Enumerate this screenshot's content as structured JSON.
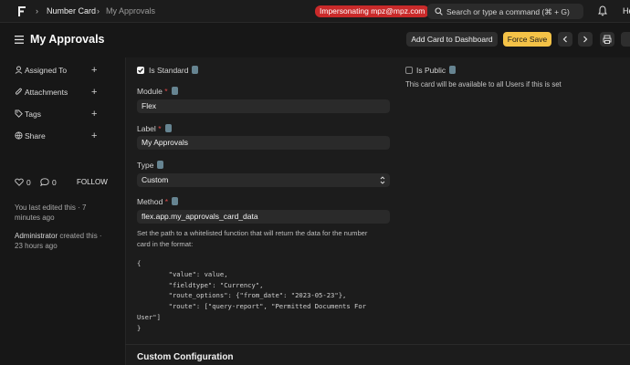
{
  "navbar": {
    "breadcrumbs": [
      "Number Card",
      "My Approvals"
    ],
    "impersonating": "Impersonating mpz@mpz.com",
    "search_placeholder": "Search or type a command (⌘ + G)",
    "user_initials_cut": "He"
  },
  "page": {
    "title": "My Approvals",
    "add_to_dashboard_label": "Add Card to Dashboard",
    "force_save_label": "Force Save"
  },
  "sidebar": {
    "items": [
      {
        "label": "Assigned To",
        "icon": "user-icon"
      },
      {
        "label": "Attachments",
        "icon": "paperclip-icon"
      },
      {
        "label": "Tags",
        "icon": "tag-icon"
      },
      {
        "label": "Share",
        "icon": "share-icon"
      }
    ],
    "likes": "0",
    "comments": "0",
    "follow_label": "FOLLOW",
    "edited_text": "You last edited this · 7 minutes ago",
    "created_by": "Administrator",
    "created_text": " created this · 23 hours ago"
  },
  "form": {
    "is_standard_label": "Is Standard",
    "is_standard_checked": true,
    "is_public_label": "Is Public",
    "is_public_checked": false,
    "is_public_desc": "This card will be available to all Users if this is set",
    "module_label": "Module",
    "module_value": "Flex",
    "label_label": "Label",
    "label_value": "My Approvals",
    "type_label": "Type",
    "type_value": "Custom",
    "method_label": "Method",
    "method_value": "flex.app.my_approvals_card_data",
    "method_desc_line1": "Set the path to a whitelisted function that will return the data for the number",
    "method_desc_line2": "card in the format:",
    "code_block": "{\n        \"value\": value,\n        \"fieldtype\": \"Currency\",\n        \"route_options\": {\"from_date\": \"2023-05-23\"},\n        \"route\": [\"query-report\", \"Permitted Documents For\nUser\"]\n}",
    "custom_config_title": "Custom Configuration"
  },
  "colors": {
    "background": "#171717",
    "panel": "#1c1c1c",
    "badge_red": "#c92a2a",
    "force_save_yellow": "#f4c247"
  }
}
